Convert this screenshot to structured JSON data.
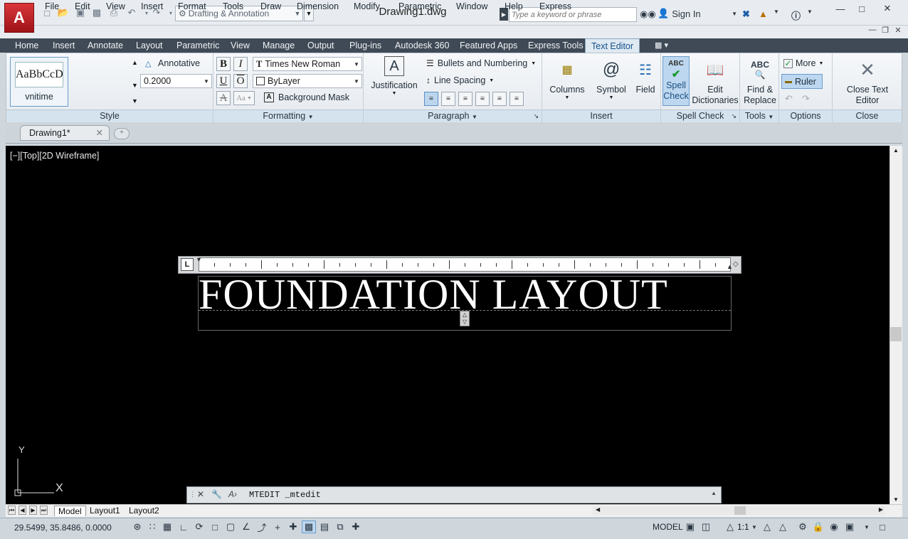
{
  "app": {
    "document_title": "Drawing1.dwg",
    "workspace": "Drafting & Annotation",
    "search_placeholder": "Type a keyword or phrase",
    "sign_in": "Sign In"
  },
  "menu": [
    "File",
    "Edit",
    "View",
    "Insert",
    "Format",
    "Tools",
    "Draw",
    "Dimension",
    "Modify",
    "Parametric",
    "Window",
    "Help",
    "Express"
  ],
  "ribbon_tabs": [
    "Home",
    "Insert",
    "Annotate",
    "Layout",
    "Parametric",
    "View",
    "Manage",
    "Output",
    "Plug-ins",
    "Autodesk 360",
    "Featured Apps",
    "Express Tools",
    "Text Editor"
  ],
  "active_ribbon_tab": "Text Editor",
  "ribbon": {
    "style": {
      "panel_label": "Style",
      "preview_text": "AaBbCcD",
      "style_name": "vnitime",
      "annotative_label": "Annotative",
      "text_height": "0.2000"
    },
    "formatting": {
      "panel_label": "Formatting",
      "bold": "B",
      "italic": "I",
      "underline": "U",
      "overline": "O",
      "strike": "A",
      "case": "Aa",
      "font": "Times New Roman",
      "color": "ByLayer",
      "background_mask": "Background Mask"
    },
    "paragraph": {
      "panel_label": "Paragraph",
      "justification": "Justification",
      "bullets": "Bullets and Numbering",
      "line_spacing": "Line Spacing"
    },
    "insert": {
      "panel_label": "Insert",
      "columns": "Columns",
      "symbol": "Symbol",
      "field": "Field"
    },
    "spell_check": {
      "panel_label": "Spell Check",
      "spell_line1": "Spell",
      "spell_line2": "Check",
      "edit_line1": "Edit",
      "edit_line2": "Dictionaries"
    },
    "tools": {
      "panel_label": "Tools",
      "find_line1": "Find &",
      "find_line2": "Replace"
    },
    "options": {
      "panel_label": "Options",
      "more": "More",
      "ruler": "Ruler"
    },
    "close": {
      "panel_label": "Close",
      "close_text_editor": "Close Text Editor"
    }
  },
  "file_tab": "Drawing1*",
  "viewport_label": "[−][Top][2D Wireframe]",
  "mtext_content": "FOUNDATION LAYOUT",
  "ucs": {
    "y_label": "Y",
    "x_label": "X"
  },
  "command_line": "MTEDIT _mtedit",
  "layout_tabs": [
    "Model",
    "Layout1",
    "Layout2"
  ],
  "status": {
    "coordinates": "29.5499, 35.8486, 0.0000",
    "space": "MODEL",
    "annotation_scale": "1:1"
  },
  "colors": {
    "canvas": "#000000",
    "ribbon_tab_bar": "#3f4a56",
    "active_tab": "#dfe9f2",
    "highlight": "#bcd7ef",
    "logo": "#c42127"
  }
}
